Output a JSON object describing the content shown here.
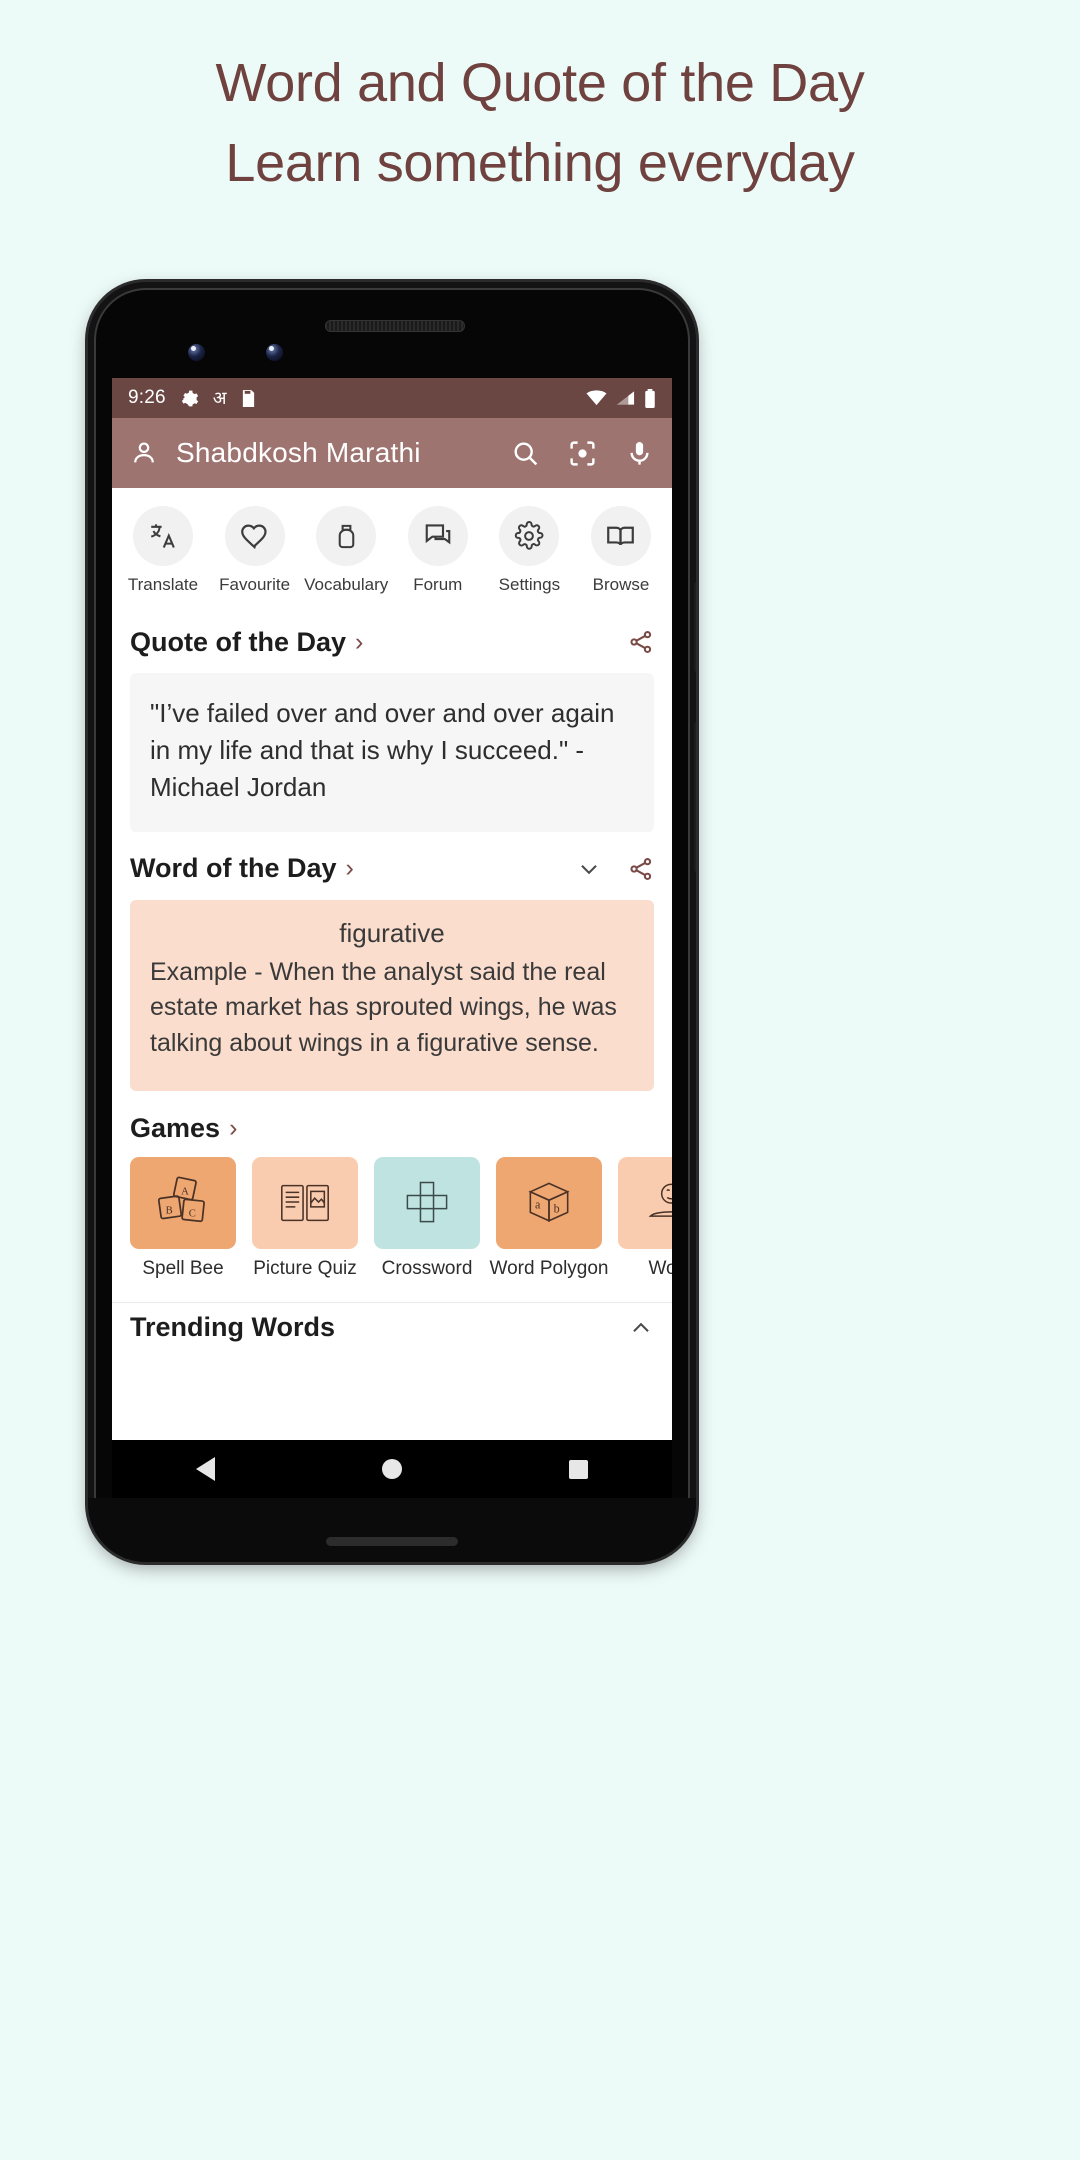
{
  "promo": {
    "headline_line1": "Word and Quote of the Day",
    "headline_line2": "Learn something everyday",
    "background_color": "#EDFBF8",
    "headline_color": "#6F423F"
  },
  "status_bar": {
    "time": "9:26",
    "icons": [
      "gear-icon",
      "devanagari-a-icon",
      "sim-card-icon"
    ],
    "devanagari_glyph": "अ",
    "right_icons": [
      "wifi-icon",
      "signal-icon",
      "battery-icon"
    ],
    "background_color": "#6B4744"
  },
  "app_bar": {
    "title": "Shabdkosh Marathi",
    "profile_icon": "person-icon",
    "actions": [
      "search-icon",
      "scan-icon",
      "microphone-icon"
    ],
    "background_color": "#9E7471"
  },
  "quick_actions": [
    {
      "label": "Translate",
      "icon": "translate-icon"
    },
    {
      "label": "Favourite",
      "icon": "heart-icon"
    },
    {
      "label": "Vocabulary",
      "icon": "vocabulary-jar-icon"
    },
    {
      "label": "Forum",
      "icon": "forum-icon"
    },
    {
      "label": "Settings",
      "icon": "gear-icon"
    },
    {
      "label": "Browse",
      "icon": "book-open-icon"
    }
  ],
  "quote_of_the_day": {
    "title": "Quote of the Day",
    "chevron": "›",
    "share_icon": "share-icon",
    "text": "\"I’ve failed over and over and over again in my life and that is why I succeed.\" - Michael Jordan",
    "card_background": "#F6F6F6"
  },
  "word_of_the_day": {
    "title": "Word of the Day",
    "chevron": "›",
    "expand_icon": "chevron-down-icon",
    "share_icon": "share-icon",
    "word": "figurative",
    "example": "Example - When the analyst said the real estate market has sprouted wings, he was talking about wings in a figurative sense.",
    "card_background": "#FBDDCD"
  },
  "games": {
    "title": "Games",
    "chevron": "›",
    "items": [
      {
        "label": "Spell Bee",
        "icon": "letter-blocks-icon",
        "tile_color": "#EFA772"
      },
      {
        "label": "Picture Quiz",
        "icon": "open-book-picture-icon",
        "tile_color": "#FACCAF"
      },
      {
        "label": "Crossword",
        "icon": "crossword-grid-icon",
        "tile_color": "#BFE3E0"
      },
      {
        "label": "Word Polygon",
        "icon": "ab-cube-icon",
        "tile_color": "#EFA772"
      },
      {
        "label": "Word",
        "icon": "word-game-icon",
        "tile_color": "#FACCAF"
      }
    ]
  },
  "trending_words": {
    "title": "Trending Words",
    "collapse_icon": "chevron-up-icon"
  },
  "navigation_bar": {
    "back": "back-triangle-icon",
    "home": "home-circle-icon",
    "recents": "recents-square-icon"
  }
}
